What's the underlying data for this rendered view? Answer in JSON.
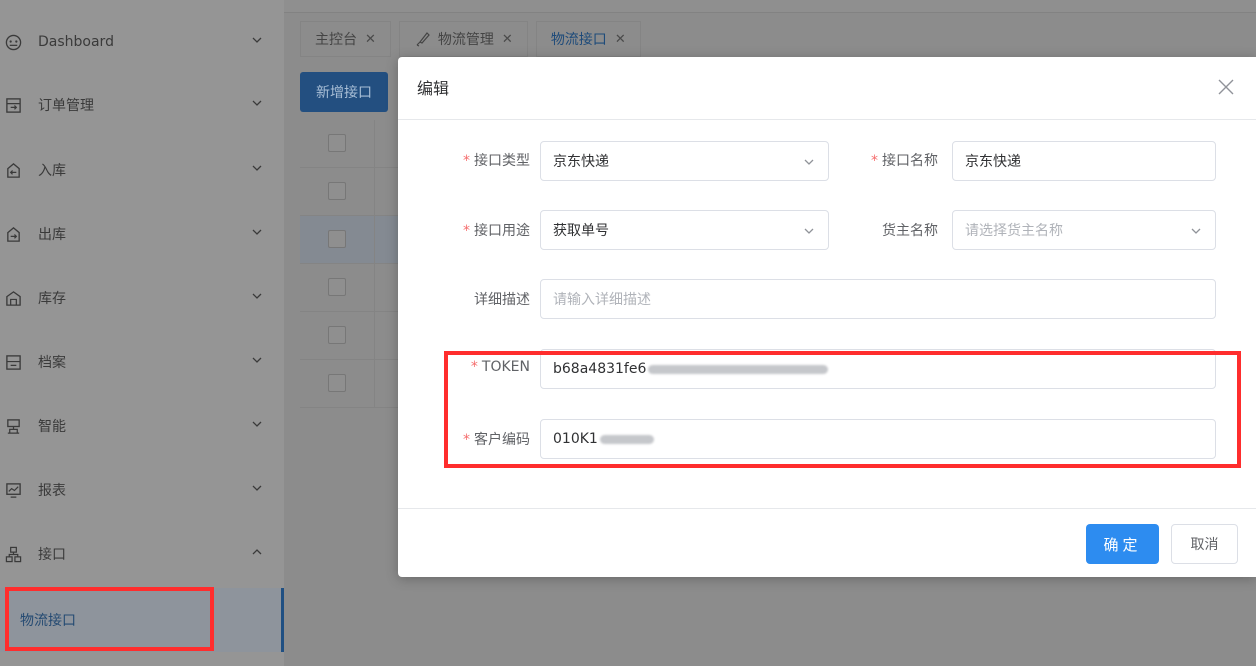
{
  "sidebar": {
    "items": [
      {
        "label": "Dashboard",
        "icon": "dashboard-icon"
      },
      {
        "label": "订单管理",
        "icon": "order-icon"
      },
      {
        "label": "入库",
        "icon": "inbound-icon"
      },
      {
        "label": "出库",
        "icon": "outbound-icon"
      },
      {
        "label": "库存",
        "icon": "inventory-icon"
      },
      {
        "label": "档案",
        "icon": "archive-icon"
      },
      {
        "label": "智能",
        "icon": "smart-icon"
      },
      {
        "label": "报表",
        "icon": "report-icon"
      },
      {
        "label": "接口",
        "icon": "interface-icon"
      }
    ],
    "sub_item": "物流接口"
  },
  "tabs": [
    {
      "label": "主控台"
    },
    {
      "label": "物流管理"
    },
    {
      "label": "物流接口"
    }
  ],
  "toolbar": {
    "add_label": "新增接口"
  },
  "modal": {
    "title": "编辑",
    "interface_type": {
      "label": "接口类型",
      "value": "京东快递"
    },
    "interface_name": {
      "label": "接口名称",
      "value": "京东快递"
    },
    "interface_use": {
      "label": "接口用途",
      "value": "获取单号"
    },
    "owner_name": {
      "label": "货主名称",
      "placeholder": "请选择货主名称"
    },
    "description": {
      "label": "详细描述",
      "placeholder": "请输入详细描述"
    },
    "token": {
      "label": "TOKEN",
      "value": "b68a4831fe6"
    },
    "customer_code": {
      "label": "客户编码",
      "value": "010K1"
    },
    "ok_label": "确定",
    "cancel_label": "取消"
  },
  "colors": {
    "primary": "#2d8cf0",
    "required": "#f56c6c",
    "highlight": "#ff2d2d"
  }
}
